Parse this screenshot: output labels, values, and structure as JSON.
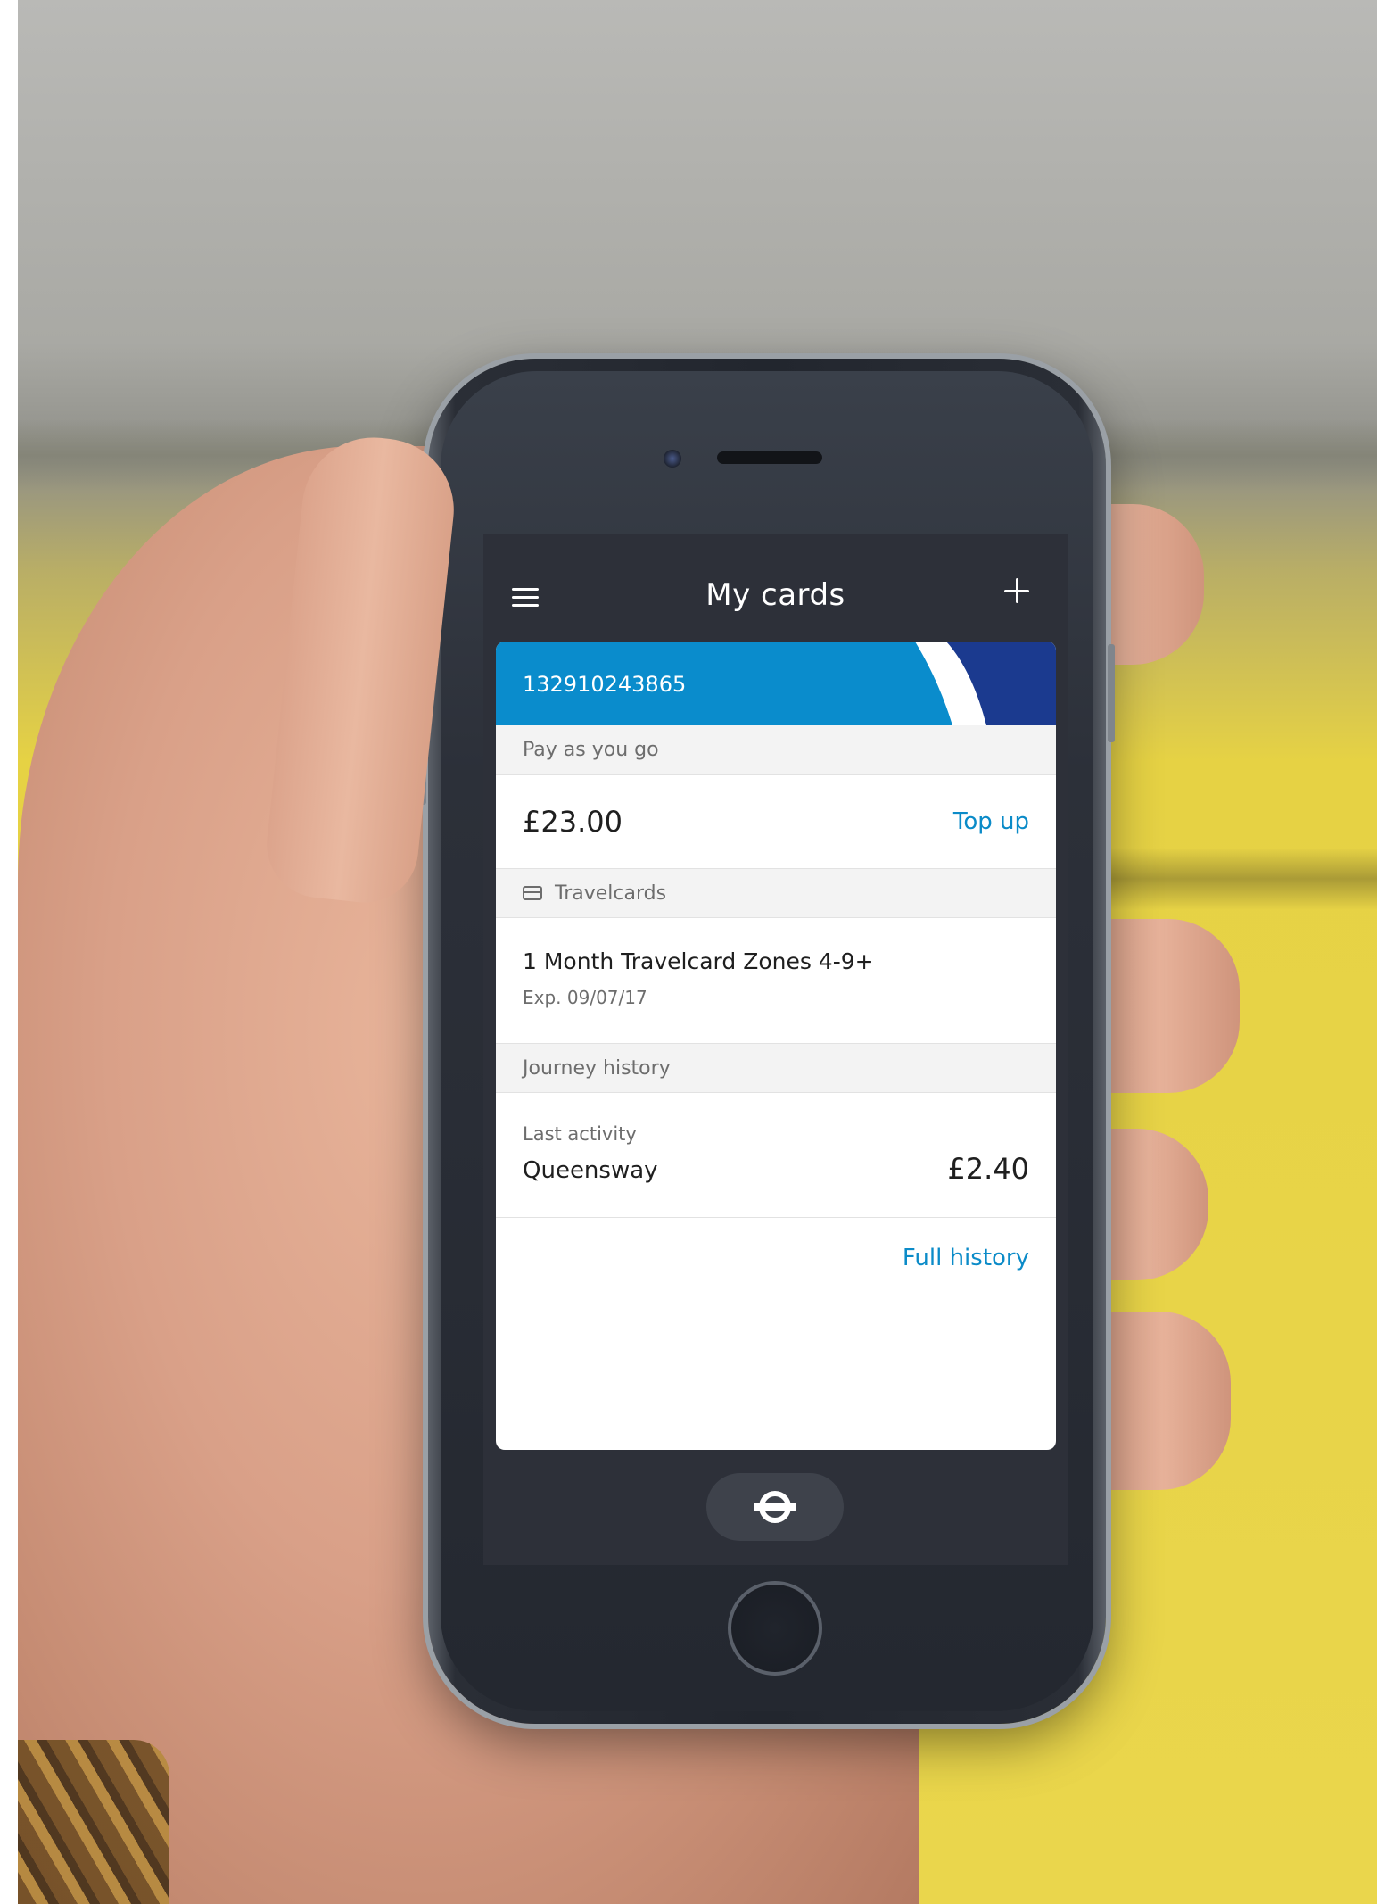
{
  "header": {
    "title": "My cards"
  },
  "card": {
    "number": "132910243865"
  },
  "payg": {
    "section_label": "Pay as you go",
    "balance": "£23.00",
    "top_up_label": "Top up"
  },
  "travelcards": {
    "section_label": "Travelcards",
    "name": "1 Month Travelcard Zones 4-9+",
    "expiry": "Exp. 09/07/17"
  },
  "journey": {
    "section_label": "Journey history",
    "last_activity_label": "Last activity",
    "station": "Queensway",
    "amount": "£2.40",
    "full_history_label": "Full history"
  },
  "colors": {
    "brand_blue": "#0a8ccc",
    "brand_dark_blue": "#1b3a8f",
    "link_blue": "#0b8bc8",
    "header_dark": "#2d3039"
  },
  "icons": {
    "menu": "hamburger-menu-icon",
    "add": "plus-icon",
    "travelcard": "card-icon",
    "bottom": "tfl-roundel-icon"
  }
}
